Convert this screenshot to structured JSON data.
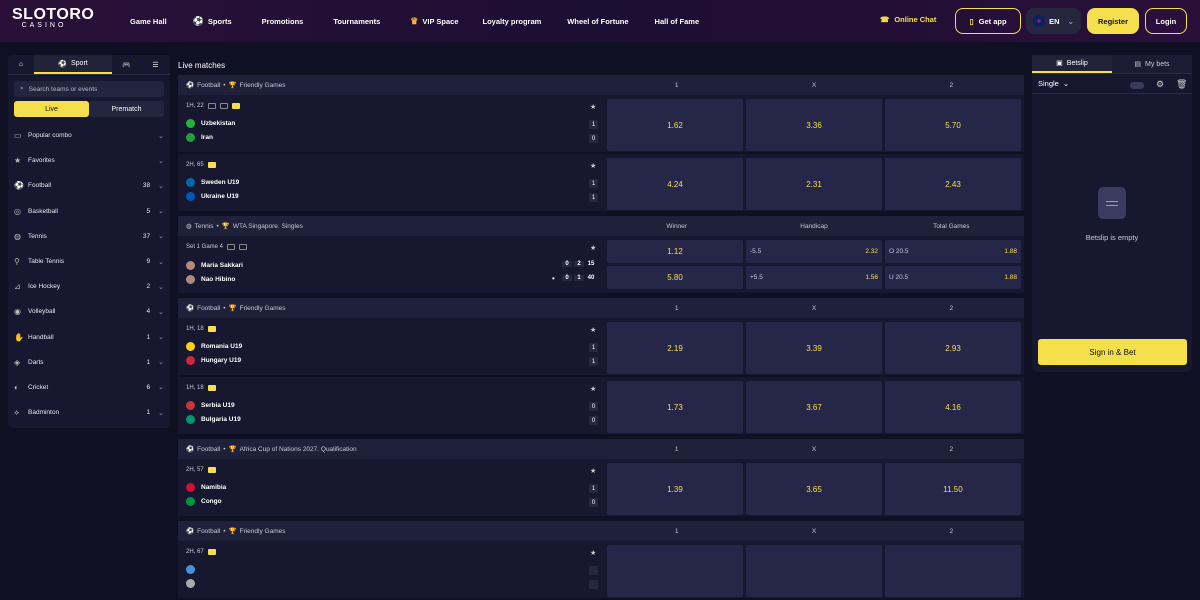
{
  "brand": {
    "logo_top": "SLOTORO",
    "logo_bottom": "CASINO",
    "accent": "#f4e04d"
  },
  "nav": [
    {
      "label": "Game Hall",
      "icon": ""
    },
    {
      "label": "Sports",
      "icon": "soccer-ball-icon"
    },
    {
      "label": "Promotions",
      "icon": ""
    },
    {
      "label": "Tournaments",
      "icon": ""
    },
    {
      "label": "VIP Space",
      "icon": "crown-icon"
    },
    {
      "label": "Loyalty program",
      "icon": ""
    },
    {
      "label": "Wheel of Fortune",
      "icon": ""
    },
    {
      "label": "Hall of Fame",
      "icon": ""
    }
  ],
  "header": {
    "online_chat": "Online Chat",
    "get_app": "Get app",
    "lang": "EN",
    "register": "Register",
    "login": "Login"
  },
  "left": {
    "tab_sport": "Sport",
    "search_placeholder": "Search teams or events",
    "live": "Live",
    "prematch": "Prematch",
    "sports": [
      {
        "label": "Popular combo",
        "count": "",
        "icon": "combo-icon"
      },
      {
        "label": "Favorites",
        "count": "",
        "icon": "star-icon"
      },
      {
        "label": "Football",
        "count": "38",
        "icon": "soccer-ball-icon"
      },
      {
        "label": "Basketball",
        "count": "5",
        "icon": "basketball-icon"
      },
      {
        "label": "Tennis",
        "count": "37",
        "icon": "tennis-icon"
      },
      {
        "label": "Table Tennis",
        "count": "9",
        "icon": "table-tennis-icon"
      },
      {
        "label": "Ice Hockey",
        "count": "2",
        "icon": "ice-hockey-icon"
      },
      {
        "label": "Volleyball",
        "count": "4",
        "icon": "volleyball-icon"
      },
      {
        "label": "Handball",
        "count": "1",
        "icon": "handball-icon"
      },
      {
        "label": "Darts",
        "count": "1",
        "icon": "darts-icon"
      },
      {
        "label": "Cricket",
        "count": "6",
        "icon": "cricket-icon"
      },
      {
        "label": "Badminton",
        "count": "1",
        "icon": "badminton-icon"
      }
    ]
  },
  "center": {
    "title": "Live matches",
    "blocks": [
      {
        "sport": "Football",
        "league": "Friendly Games",
        "cols": [
          "1",
          "X",
          "2"
        ],
        "matches": [
          {
            "time": "1H, 22",
            "home": "Uzbekistan",
            "away": "Iran",
            "hs": "1",
            "as": "0",
            "odds": [
              "1.62",
              "3.36",
              "5.70"
            ],
            "hc": "#1eb53a",
            "ac": "#239f40"
          },
          {
            "time": "2H, 65",
            "home": "Sweden U19",
            "away": "Ukraine U19",
            "hs": "1",
            "as": "1",
            "odds": [
              "4.24",
              "2.31",
              "2.43"
            ],
            "hc": "#006aa7",
            "ac": "#0057b7"
          }
        ]
      },
      {
        "sport": "Tennis",
        "league": "WTA Singapore. Singles",
        "cols": [
          "Winner",
          "Handicap",
          "Total Games"
        ],
        "tennis": {
          "time": "Set 1 Game 4",
          "p1": "Maria Sakkari",
          "p2": "Nao Hibino",
          "p1s": [
            "0",
            "2",
            "15"
          ],
          "p2s": [
            "0",
            "1",
            "40"
          ],
          "w1": "1.12",
          "w2": "5.80",
          "h1l": "-5.5",
          "h1o": "2.32",
          "h2l": "+5.5",
          "h2o": "1.56",
          "t1l": "O 20.5",
          "t1o": "1.88",
          "t2l": "U 20.5",
          "t2o": "1.88"
        }
      },
      {
        "sport": "Football",
        "league": "Friendly Games",
        "cols": [
          "1",
          "X",
          "2"
        ],
        "matches": [
          {
            "time": "1H, 18",
            "home": "Romania U19",
            "away": "Hungary U19",
            "hs": "1",
            "as": "1",
            "odds": [
              "2.19",
              "3.39",
              "2.93"
            ],
            "hc": "#fcd116",
            "ac": "#ce2939"
          },
          {
            "time": "1H, 18",
            "home": "Serbia U19",
            "away": "Bulgaria U19",
            "hs": "0",
            "as": "0",
            "odds": [
              "1.73",
              "3.67",
              "4.16"
            ],
            "hc": "#c6363c",
            "ac": "#00966e"
          }
        ]
      },
      {
        "sport": "Football",
        "league": "Africa Cup of Nations 2027. Qualification",
        "cols": [
          "1",
          "X",
          "2"
        ],
        "matches": [
          {
            "time": "2H, 57",
            "home": "Namibia",
            "away": "Congo",
            "hs": "1",
            "as": "0",
            "odds": [
              "1.39",
              "3.65",
              "11.50"
            ],
            "hc": "#d21034",
            "ac": "#009543"
          }
        ]
      },
      {
        "sport": "Football",
        "league": "Friendly Games",
        "cols": [
          "1",
          "X",
          "2"
        ],
        "matches": [
          {
            "time": "2H, 67",
            "home": "",
            "away": "",
            "hs": "",
            "as": "",
            "odds": [
              "",
              "",
              ""
            ],
            "hc": "#4a90d9",
            "ac": "#aaaaaa"
          }
        ]
      }
    ]
  },
  "betslip": {
    "tab_betslip": "Betslip",
    "tab_mybets": "My bets",
    "mode": "Single",
    "empty": "Betslip is empty",
    "signin": "Sign in & Bet"
  }
}
